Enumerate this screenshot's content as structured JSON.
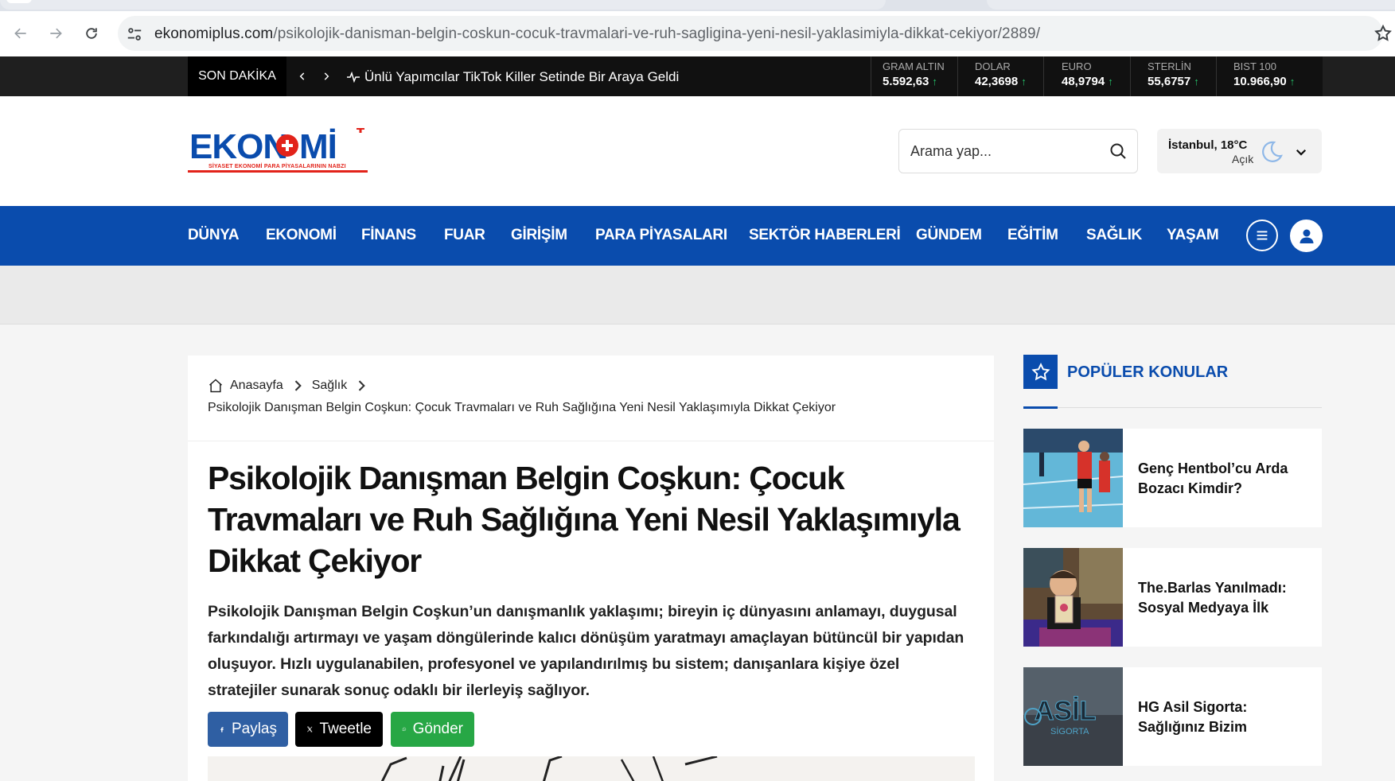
{
  "browser": {
    "url_host": "ekonomiplus.com",
    "url_path": "/psikolojik-danisman-belgin-coskun-cocuk-travmalari-ve-ruh-sagligina-yeni-nesil-yaklasimiyla-dikkat-cekiyor/2889/"
  },
  "ticker": {
    "label": "SON DAKİKA",
    "headline": "Ünlü Yapımcılar TikTok Killer Setinde Bir Araya Geldi",
    "markets": [
      {
        "name": "GRAM ALTIN",
        "value": "5.592,63",
        "trend": "↑"
      },
      {
        "name": "DOLAR",
        "value": "42,3698",
        "trend": "↑"
      },
      {
        "name": "EURO",
        "value": "48,9794",
        "trend": "↑"
      },
      {
        "name": "STERLİN",
        "value": "55,6757",
        "trend": "↑"
      },
      {
        "name": "BIST 100",
        "value": "10.966,90",
        "trend": "↑"
      }
    ]
  },
  "header": {
    "logo_text": "EKONOMİ",
    "logo_tagline": "SİYASET EKONOMİ PARA PİYASALARININ NABZI",
    "search_placeholder": "Arama yap...",
    "weather_city": "İstanbul, 18°C",
    "weather_condition": "Açık"
  },
  "nav": {
    "items": [
      "DÜNYA",
      "EKONOMİ",
      "FİNANS",
      "FUAR",
      "GİRİŞİM",
      "PARA PİYASALARI",
      "SEKTÖR HABERLERİ",
      "GÜNDEM",
      "EĞİTİM",
      "SAĞLIK",
      "YAŞAM"
    ]
  },
  "article": {
    "breadcrumb_home": "Anasayfa",
    "breadcrumb_category": "Sağlık",
    "breadcrumb_current": "Psikolojik Danışman Belgin Coşkun: Çocuk Travmaları ve Ruh Sağlığına Yeni Nesil Yaklaşımıyla Dikkat Çekiyor",
    "title": "Psikolojik Danışman Belgin Coşkun: Çocuk Travmaları ve Ruh Sağlığına Yeni Nesil Yaklaşımıyla Dikkat Çekiyor",
    "lead": "Psikolojik Danışman Belgin Coşkun’un danışmanlık yaklaşımı; bireyin iç dünyasını anlamayı, duygusal farkındalığı artırmayı ve yaşam döngülerinde kalıcı dönüşüm yaratmayı amaçlayan bütüncül bir yapıdan oluşuyor. Hızlı uygulanabilen, profesyonel ve yapılandırılmış bu sistem; danışanlara kişiye özel stratejiler sunarak sonuç odaklı bir ilerleyiş sağlıyor.",
    "share_facebook": "Paylaş",
    "share_twitter": "Tweetle",
    "share_whatsapp": "Gönder"
  },
  "sidebar": {
    "title": "POPÜLER KONULAR",
    "items": [
      {
        "title": "Genç Hentbol’cu Arda Bozacı Kimdir?"
      },
      {
        "title": "The.Barlas Yanılmadı: Sosyal Medyaya İlk"
      },
      {
        "title": "HG Asil Sigorta: Sağlığınız Bizim"
      }
    ]
  },
  "colors": {
    "brand_blue": "#0a4cad",
    "brand_red": "#e2231a",
    "ticker_bg": "#111111",
    "trend_up": "#25c26a",
    "facebook": "#2f5fa3",
    "whatsapp": "#27a745"
  }
}
